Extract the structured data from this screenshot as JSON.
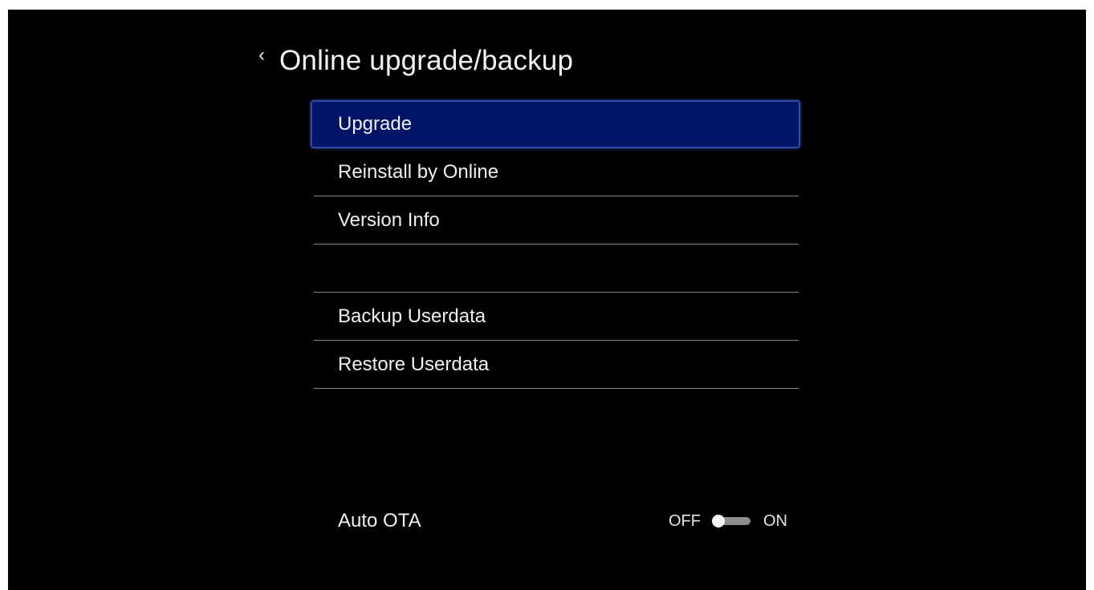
{
  "header": {
    "back_icon": "‹",
    "title": "Online upgrade/backup"
  },
  "menu": {
    "items": [
      {
        "label": "Upgrade",
        "selected": true
      },
      {
        "label": "Reinstall by Online"
      },
      {
        "label": "Version Info"
      },
      {
        "label": ""
      },
      {
        "label": "Backup Userdata"
      },
      {
        "label": "Restore Userdata"
      }
    ]
  },
  "auto_ota": {
    "label": "Auto OTA",
    "off_label": "OFF",
    "on_label": "ON",
    "state": "OFF"
  },
  "colors": {
    "background": "#000000",
    "selected_item": "#001466",
    "selected_border": "#2f4aa8",
    "divider": "#8a8a8a"
  }
}
